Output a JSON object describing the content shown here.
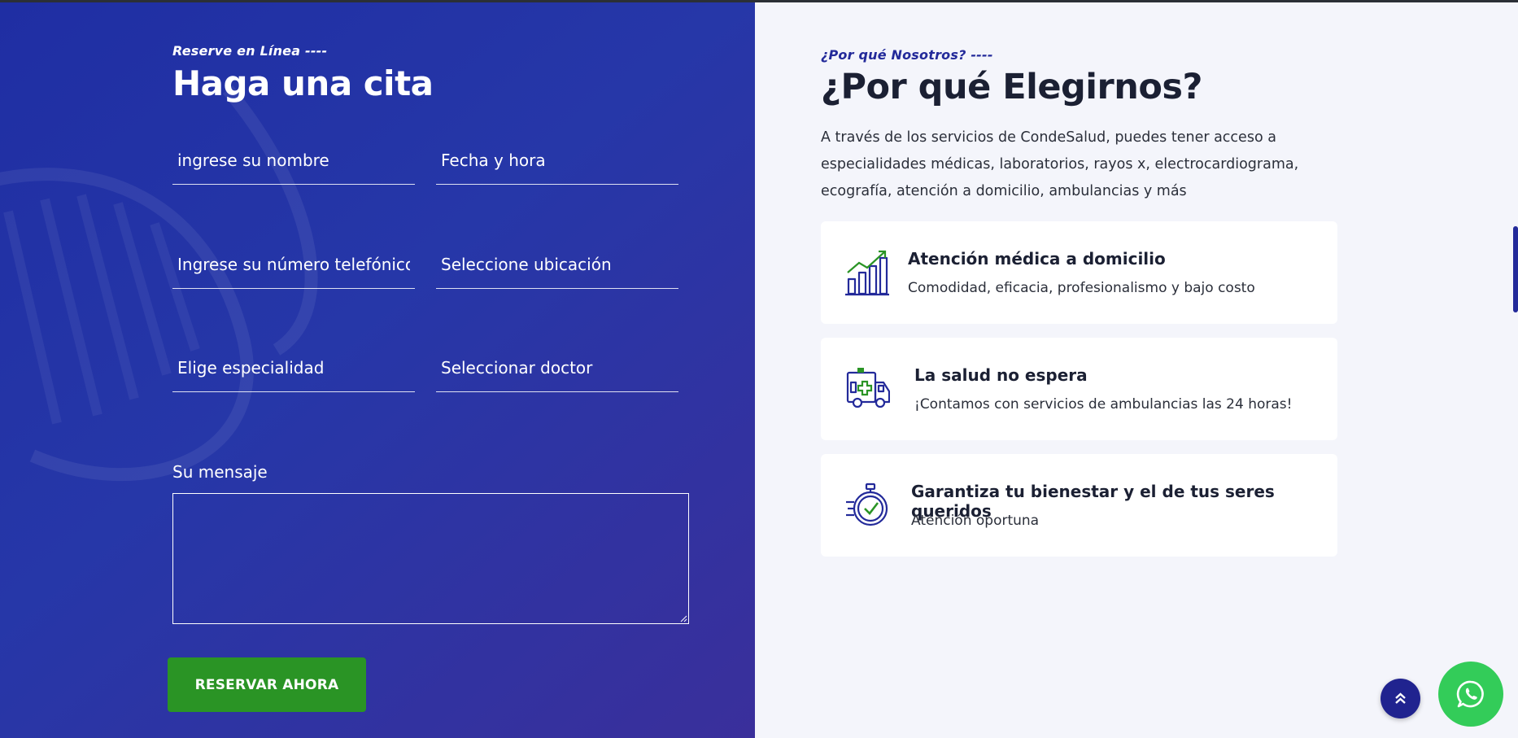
{
  "colors": {
    "form_bg": "#2637a8",
    "primary": "#232a9a",
    "submit_button": "#2a9425",
    "whatsapp": "#33cc59",
    "right_bg": "#f4f5fb",
    "icon_green": "#2a9425"
  },
  "booking": {
    "eyebrow": "Reserve en Línea ----",
    "title": "Haga una cita",
    "fields": {
      "name_placeholder": "ingrese su nombre",
      "date_placeholder": "Fecha y hora",
      "phone_placeholder": "Ingrese su número telefónico",
      "location_placeholder": "Seleccione ubicación",
      "specialty_placeholder": "Elige especialidad",
      "doctor_placeholder": "Seleccionar doctor"
    },
    "message_label": "Su mensaje",
    "message_value": "",
    "submit_label": "RESERVAR AHORA"
  },
  "why": {
    "eyebrow": "¿Por qué Nosotros? ----",
    "title": "¿Por qué Elegirnos?",
    "intro": "A través de los servicios de CondeSalud, puedes tener acceso a especialidades médicas, laboratorios, rayos x, electrocardiograma, ecografía, atención a domicilio, ambulancias y más",
    "features": [
      {
        "icon": "growth-chart-icon",
        "title": "Atención médica a domicilio",
        "text": "Comodidad, eficacia, profesionalismo y bajo costo"
      },
      {
        "icon": "ambulance-icon",
        "title": "La salud no espera",
        "text": "¡Contamos con servicios de ambulancias las 24 horas!"
      },
      {
        "icon": "stopwatch-icon",
        "title": "Garantiza tu bienestar y el de tus seres queridos",
        "text": "Atención oportuna"
      }
    ]
  },
  "floating": {
    "scroll_top_icon": "double-chevron-up-icon",
    "whatsapp_icon": "whatsapp-icon"
  }
}
